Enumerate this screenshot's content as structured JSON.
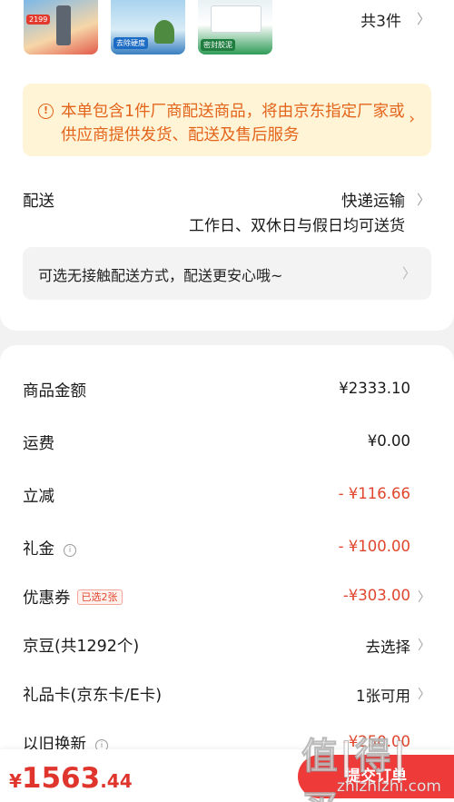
{
  "products": {
    "thumbs": [
      {
        "badge": "2199"
      },
      {
        "badge": "去除硬度"
      },
      {
        "badge": "密封胶泥"
      }
    ],
    "count_label": "共3件"
  },
  "notice": {
    "text": "本单包含1件厂商配送商品，将由京东指定厂家或供应商提供发货、配送及售后服务"
  },
  "delivery": {
    "label": "配送",
    "method": "快递运输",
    "time": "工作日、双休日与假日均可送货"
  },
  "contactless": {
    "text": "可选无接触配送方式，配送更安心哦~"
  },
  "fees": {
    "goods_amount": {
      "label": "商品金额",
      "value": "¥2333.10"
    },
    "shipping": {
      "label": "运费",
      "value": "¥0.00"
    },
    "discount": {
      "label": "立减",
      "value": "- ¥116.66"
    },
    "gift_money": {
      "label": "礼金",
      "value": "- ¥100.00"
    },
    "coupon": {
      "label": "优惠券",
      "tag": "已选2张",
      "value": "-¥303.00"
    },
    "jingdou": {
      "label": "京豆(共1292个)",
      "value": "去选择"
    },
    "gift_card": {
      "label": "礼品卡(京东卡/E卡)",
      "value": "1张可用"
    },
    "trade_in": {
      "label": "以旧换新",
      "value": "-¥250.00"
    }
  },
  "footer": {
    "currency": "¥",
    "total_int": "1563",
    "total_dec": ".44",
    "submit_label": "提交订单"
  },
  "watermark": {
    "big": "值|得|买",
    "small": "zhizhizhi.com"
  },
  "colors": {
    "accent_red": "#e0462d",
    "notice_orange": "#e3641b",
    "notice_bg": "#fff4d6",
    "submit_bg": "#ef3a3a"
  },
  "icons": [
    "info-icon",
    "chevron-right-icon"
  ]
}
